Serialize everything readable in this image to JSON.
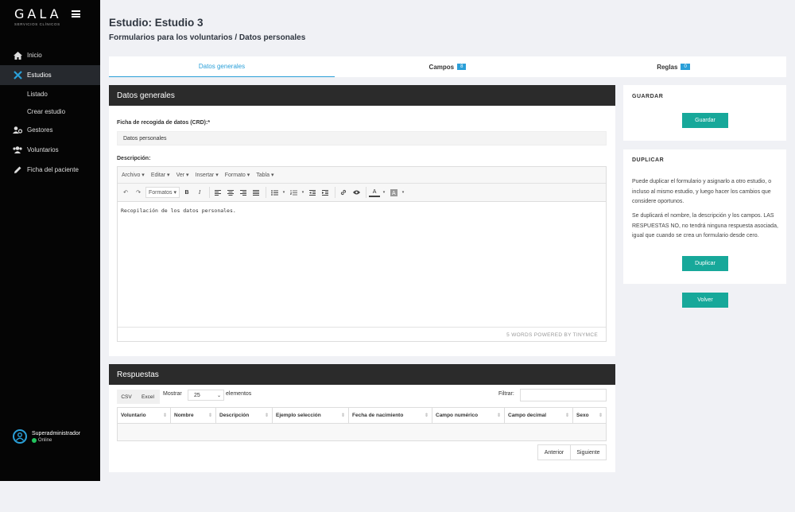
{
  "brand": {
    "name": "GALA",
    "sub": "SERVICIOS CLÍNICOS"
  },
  "nav": {
    "items": [
      "Inicio",
      "Estudios"
    ],
    "sub": [
      "Listado",
      "Crear estudio"
    ],
    "more": [
      "Gestores",
      "Voluntarios",
      "Ficha del paciente"
    ]
  },
  "user": {
    "name": "Superadministrador",
    "status": "Online"
  },
  "page": {
    "title": "Estudio: Estudio 3",
    "subtitle": "Formularios para los voluntarios / Datos personales"
  },
  "tabs": [
    {
      "label": "Datos generales"
    },
    {
      "label": "Campos",
      "badge": "8"
    },
    {
      "label": "Reglas",
      "badge": "0"
    }
  ],
  "general": {
    "header": "Datos generales",
    "crd_label": "Ficha de recogida de datos (CRD):*",
    "crd_value": "Datos personales",
    "desc_label": "Descripción:"
  },
  "editor": {
    "menu": [
      "Archivo ▾",
      "Editar ▾",
      "Ver ▾",
      "Insertar ▾",
      "Formato ▾",
      "Tabla ▾"
    ],
    "formats": "Formatos ▾",
    "content": "Recopilación de los datos personales.",
    "status": "5 WORDS POWERED BY TINYMCE"
  },
  "save": {
    "title": "GUARDAR",
    "button": "Guardar"
  },
  "duplicate": {
    "title": "DUPLICAR",
    "p1": "Puede duplicar el formulario y asignarlo a otro estudio, o incluso al mismo estudio, y luego hacer los cambios que considere oportunos.",
    "p2": "Se duplicará el nombre, la descripción y los campos. LAS RESPUESTAS NO, no tendrá ninguna respuesta asociada, igual que cuando se crea un formulario desde cero.",
    "button": "Duplicar"
  },
  "back_button": "Volver",
  "answers": {
    "header": "Respuestas",
    "csv": "CSV",
    "excel": "Excel",
    "show_label": "Mostrar",
    "show_value": "25",
    "elements": "elementos",
    "filter": "Filtrar:",
    "columns": [
      "Voluntario",
      "Nombre",
      "Descripción",
      "Ejemplo selección",
      "Fecha de nacimiento",
      "Campo numérico",
      "Campo decimal",
      "Sexo"
    ],
    "prev": "Anterior",
    "next": "Siguiente"
  },
  "colors": {
    "accent": "#2a9fd8",
    "button": "#17a89a",
    "sidebar": "#050505",
    "header": "#2b2b2b"
  }
}
